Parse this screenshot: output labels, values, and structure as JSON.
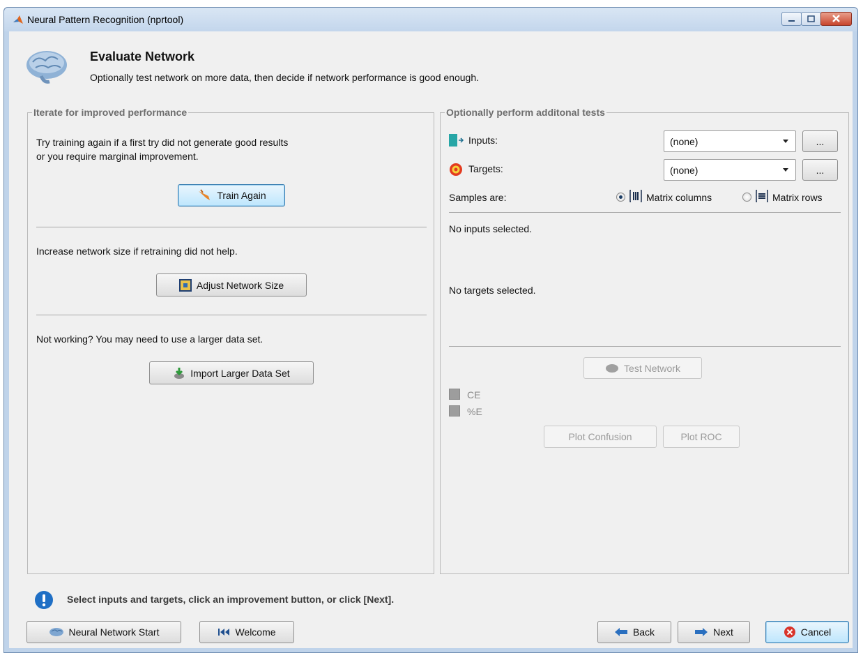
{
  "window": {
    "title": "Neural Pattern Recognition (nprtool)"
  },
  "header": {
    "title": "Evaluate Network",
    "subtitle": "Optionally test network on more data, then decide if network performance is good enough."
  },
  "left_panel": {
    "legend": "Iterate for improved performance",
    "retrain_text_1": "Try training again if a first try did not generate good results",
    "retrain_text_2": "or you require marginal improvement.",
    "train_again_label": "Train Again",
    "size_text": "Increase network size if retraining did not help.",
    "adjust_size_label": "Adjust Network Size",
    "data_text": "Not working? You may need to use a larger data set.",
    "import_label": "Import Larger Data Set"
  },
  "right_panel": {
    "legend": "Optionally perform additonal tests",
    "inputs_label": "Inputs:",
    "inputs_value": "(none)",
    "targets_label": "Targets:",
    "targets_value": "(none)",
    "browse_label": "...",
    "samples_label": "Samples are:",
    "matrix_columns_label": "Matrix columns",
    "matrix_rows_label": "Matrix rows",
    "samples_selected": "Matrix columns",
    "no_inputs": "No inputs selected.",
    "no_targets": "No targets selected.",
    "test_network_label": "Test Network",
    "ce_label": "CE",
    "pe_label": "%E",
    "plot_confusion_label": "Plot Confusion",
    "plot_roc_label": "Plot ROC"
  },
  "status": {
    "message": "Select inputs and targets, click an improvement button, or click [Next]."
  },
  "footer": {
    "nn_start_label": "Neural Network Start",
    "welcome_label": "Welcome",
    "back_label": "Back",
    "next_label": "Next",
    "cancel_label": "Cancel"
  },
  "colors": {
    "accent_blue": "#1f6fc5",
    "cancel_red": "#d9342b",
    "target_orange": "#e8701a"
  }
}
